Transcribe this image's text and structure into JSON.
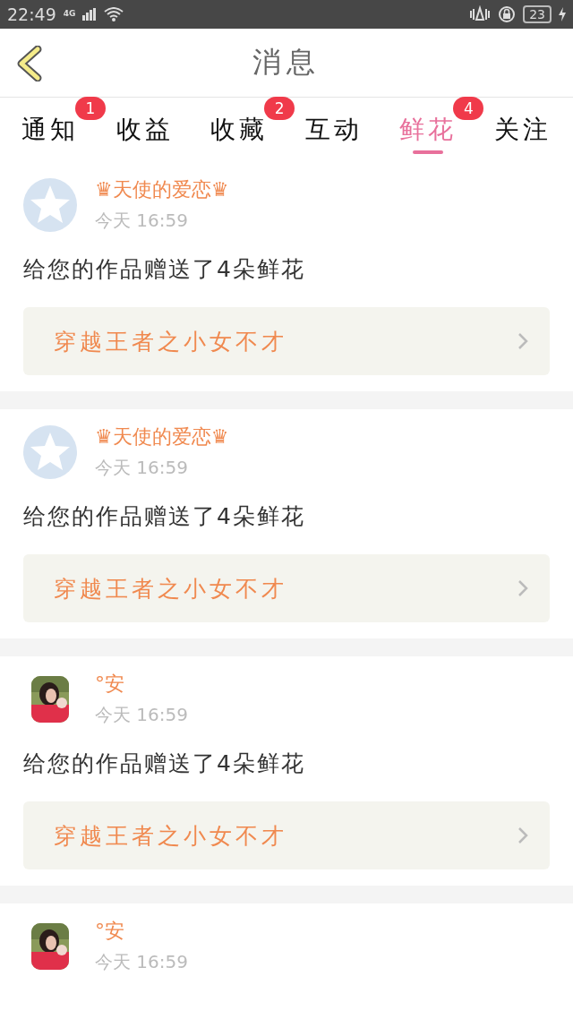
{
  "status_bar": {
    "time": "22:49",
    "network": "4G",
    "battery": "23"
  },
  "header": {
    "title": "消息"
  },
  "tabs": [
    {
      "label": "通知",
      "selected": false,
      "badge": "1"
    },
    {
      "label": "收益",
      "selected": false
    },
    {
      "label": "收藏",
      "selected": false,
      "badge": "2"
    },
    {
      "label": "互动",
      "selected": false
    },
    {
      "label": "鲜花",
      "selected": true,
      "badge": "4"
    },
    {
      "label": "关注",
      "selected": false
    }
  ],
  "messages": [
    {
      "kind": "default",
      "name": "♛天使的爱恋♛",
      "time": "今天 16:59",
      "text": "给您的作品赠送了4朵鲜花",
      "book": "穿越王者之小女不才"
    },
    {
      "kind": "default",
      "name": "♛天使的爱恋♛",
      "time": "今天 16:59",
      "text": "给您的作品赠送了4朵鲜花",
      "book": "穿越王者之小女不才"
    },
    {
      "name": "°安",
      "time": "今天 16:59",
      "text": "给您的作品赠送了4朵鲜花",
      "book": "穿越王者之小女不才"
    },
    {
      "name": "°安",
      "time": "今天 16:59"
    }
  ]
}
